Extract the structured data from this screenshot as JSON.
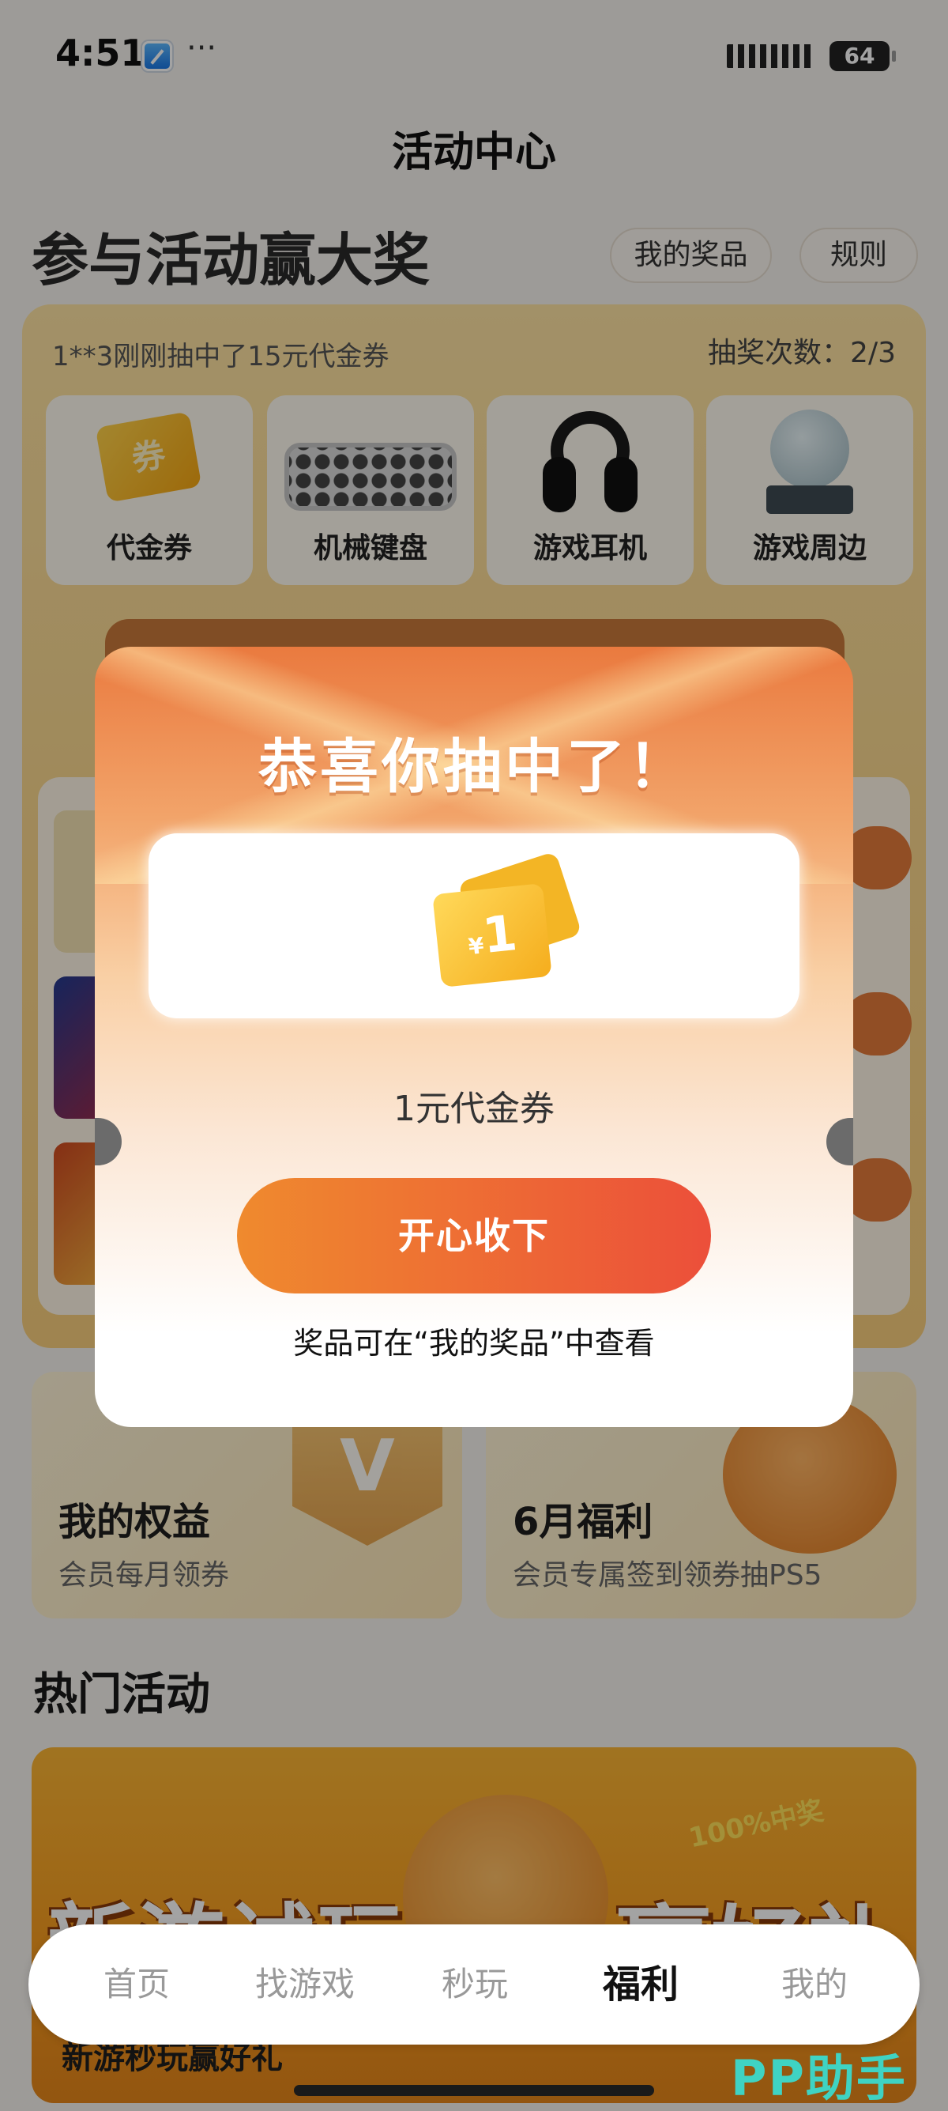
{
  "status_bar": {
    "time": "4:51",
    "more": "···",
    "battery": "64"
  },
  "header": {
    "title": "活动中心"
  },
  "hero": {
    "title": "参与活动赢大奖",
    "my_prizes_label": "我的奖品",
    "rules_label": "规则"
  },
  "lottery": {
    "ticker": "1**3刚刚抽中了15元代金券",
    "draw_count": "抽奖次数：2/3",
    "prizes": [
      {
        "label": "代金券",
        "icon": "coupon-icon"
      },
      {
        "label": "机械键盘",
        "icon": "keyboard-icon"
      },
      {
        "label": "游戏耳机",
        "icon": "headphones-icon"
      },
      {
        "label": "游戏周边",
        "icon": "figurine-icon"
      }
    ],
    "coupon_icon_text": "券"
  },
  "benefits": [
    {
      "title": "我的权益",
      "subtitle": "会员每月领券",
      "badge": "V"
    },
    {
      "title": "6月福利",
      "subtitle": "会员专属签到领券抽PS5"
    }
  ],
  "hot": {
    "section_title": "热门活动",
    "banner_text_left": "新游试玩",
    "banner_text_right": "赢好礼",
    "banner_badge": "100%中奖",
    "caption": "新游秒玩赢好礼"
  },
  "modal": {
    "title": "恭喜你抽中了！",
    "coupon_yen": "¥",
    "coupon_amount": "1",
    "prize_name": "1元代金券",
    "accept_label": "开心收下",
    "hint": "奖品可在“我的奖品”中查看"
  },
  "bottom_nav": {
    "items": [
      {
        "label": "首页"
      },
      {
        "label": "找游戏"
      },
      {
        "label": "秒玩"
      },
      {
        "label": "福利",
        "active": true
      },
      {
        "label": "我的"
      }
    ]
  },
  "watermark": "PP助手",
  "colors": {
    "accent": "#ec6a34",
    "panel": "#fbd88f",
    "watermark": "#3fd3c3"
  }
}
